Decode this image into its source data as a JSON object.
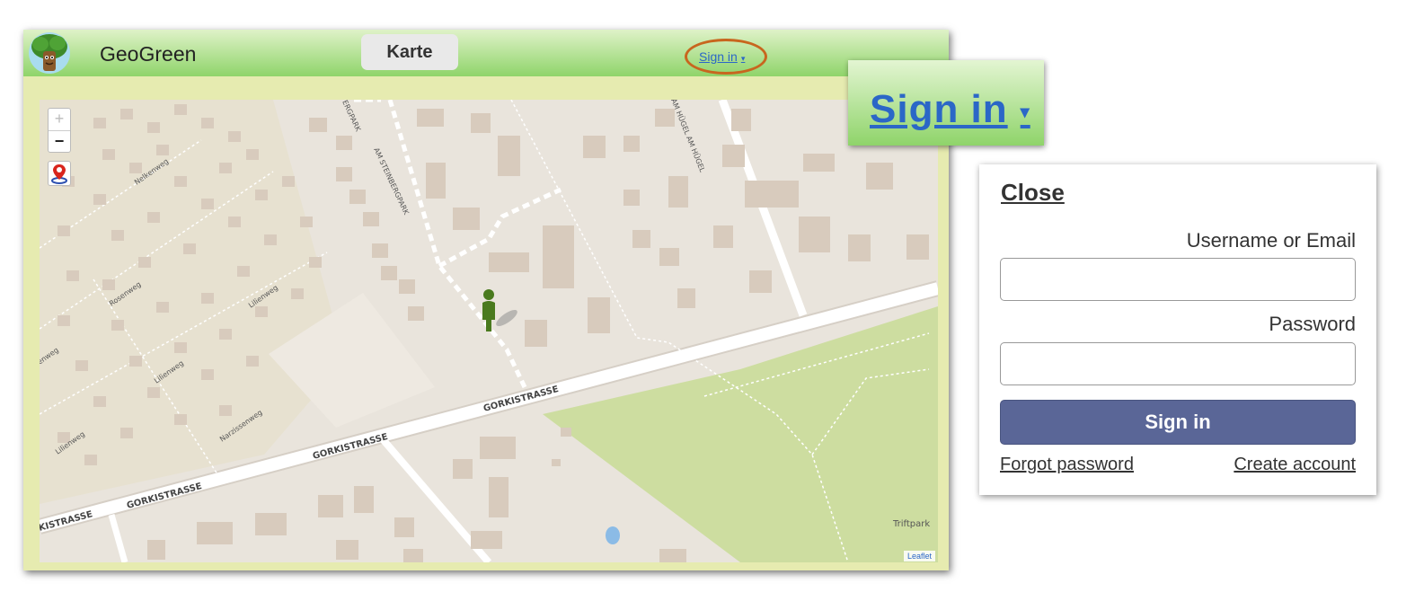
{
  "app": {
    "title": "GeoGreen",
    "tab_karte": "Karte",
    "signin_label": "Sign in",
    "signin_caret": "▾"
  },
  "map": {
    "streets": {
      "gorki_1": "GORKISTRASSE",
      "gorki_2": "GORKISTRASSE",
      "gorki_3": "GORKISTRASSE",
      "gorki_4": "KISTRASSE",
      "steinbergpark_a": "ERGPARK",
      "steinbergpark_b": "AM STEINBERGPARK",
      "am_hugel": "AM HÜGEL   AM HÜGEL",
      "nelkenweg": "Nelkenweg",
      "rosenweg": "Rosenweg",
      "lilienweg_a": "Lilienweg",
      "lilienweg_b": "Lilienweg",
      "lilienweg_c": "Lilienweg",
      "narzissenweg": "Narzissenweg",
      "enweg": "enweg",
      "triftpark": "Triftpark"
    },
    "zoom_in": "+",
    "zoom_out": "−",
    "attribution": "Leaflet"
  },
  "callout": {
    "signin_label": "Sign in",
    "signin_caret": "▾"
  },
  "login": {
    "close": "Close",
    "username_label": "Username or Email",
    "username_value": "",
    "password_label": "Password",
    "password_value": "",
    "submit": "Sign in",
    "forgot": "Forgot password",
    "create": "Create account"
  },
  "colors": {
    "topbar": "#8fd46a",
    "accent_link": "#2b67c7",
    "highlight_oval": "#c8661e",
    "signin_button": "#5a6697",
    "park": "#cddda0"
  }
}
